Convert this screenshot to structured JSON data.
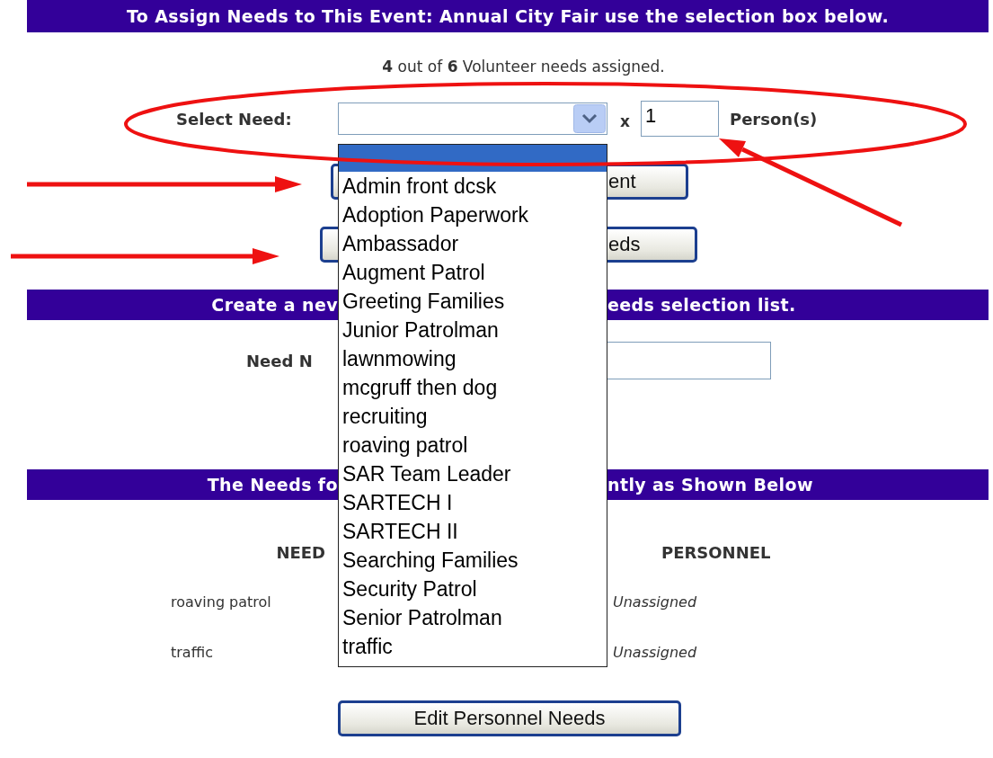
{
  "header": {
    "title": "To Assign Needs to This Event: Annual City Fair use the selection box below."
  },
  "summary": "**4** out of **6** Volunteer needs assigned.",
  "assign_form": {
    "label": "Select Need:",
    "multiplier": "x",
    "quantity": "1",
    "unit": "Person(s)"
  },
  "partial_buttons": [
    {
      "label": "ent"
    },
    {
      "label": "eds"
    }
  ],
  "create_banner": {
    "left": "Create a nev",
    "right": "eeds selection list."
  },
  "need_name": {
    "label": "Need N"
  },
  "needs_banner": {
    "left": "The Needs fo",
    "right": "ntly as Shown Below"
  },
  "table": {
    "columns": [
      "NEED",
      "PERSONNEL"
    ],
    "rows": [
      {
        "need": "roaving patrol",
        "personnel": "Unassigned"
      },
      {
        "need": "traffic",
        "personnel": "Unassigned"
      }
    ]
  },
  "edit_button": {
    "label": "Edit Personnel Needs"
  },
  "dropdown": {
    "options": [
      {
        "selected": true
      },
      {
        "label": "Admin front dcsk",
        "selected": false
      },
      {
        "label": "Adoption Paperwork",
        "selected": false
      },
      {
        "label": "Ambassador",
        "selected": false
      },
      {
        "label": "Augment Patrol",
        "selected": false
      },
      {
        "label": "Greeting Families",
        "selected": false
      },
      {
        "label": "Junior Patrolman",
        "selected": false
      },
      {
        "label": "lawnmowing",
        "selected": false
      },
      {
        "label": "mcgruff then dog",
        "selected": false
      },
      {
        "label": "recruiting",
        "selected": false
      },
      {
        "label": "roaving patrol",
        "selected": false
      },
      {
        "label": "SAR Team Leader",
        "selected": false
      },
      {
        "label": "SARTECH I",
        "selected": false
      },
      {
        "label": "SARTECH II",
        "selected": false
      },
      {
        "label": "Searching Families",
        "selected": false
      },
      {
        "label": "Security Patrol",
        "selected": false
      },
      {
        "label": "Senior Patrolman",
        "selected": false
      },
      {
        "label": "traffic",
        "selected": false
      }
    ]
  }
}
